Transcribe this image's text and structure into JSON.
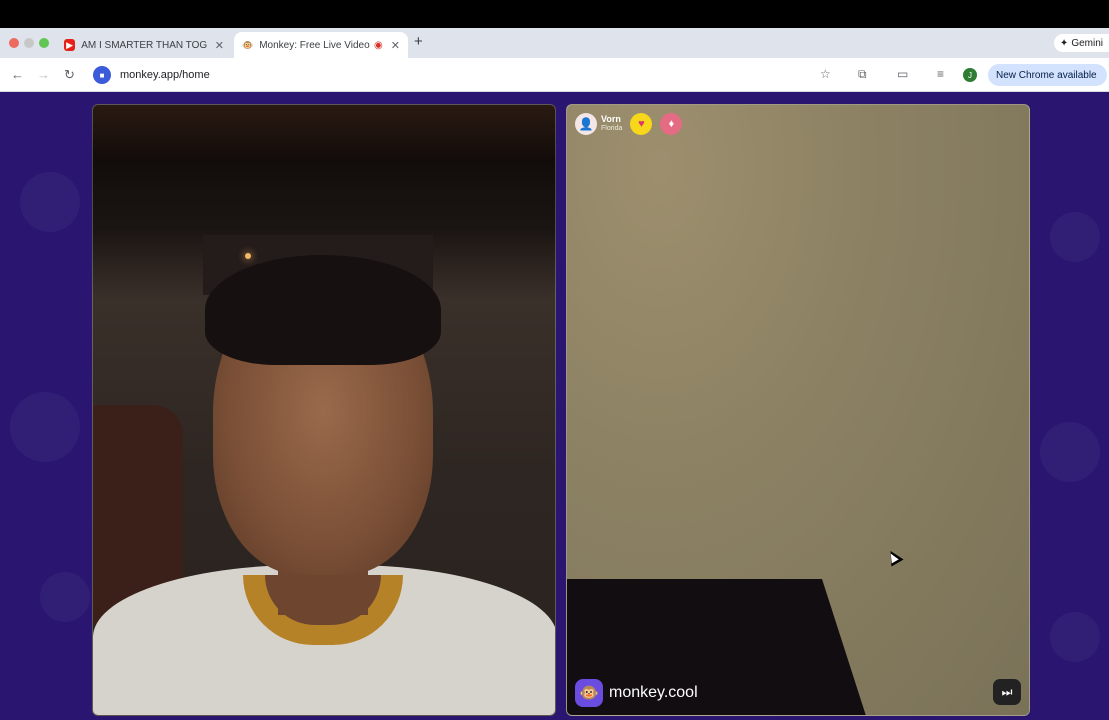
{
  "browser": {
    "tabs": [
      {
        "title": "AM I SMARTER THAN TOGI?",
        "favicon": "youtube-icon",
        "color": "#e62117"
      },
      {
        "title": "Monkey: Free Live Video C",
        "favicon": "monkey-icon"
      }
    ],
    "gemini_label": "Gemini",
    "url": "monkey.app/home",
    "chrome_update_label": "New Chrome available",
    "profile_initial": "J"
  },
  "call": {
    "peer_name": "Vorn",
    "peer_location": "Florida",
    "watermark": "monkey.cool"
  },
  "colors": {
    "page_background": "#2a1670",
    "accent": "#6a4ce0"
  }
}
